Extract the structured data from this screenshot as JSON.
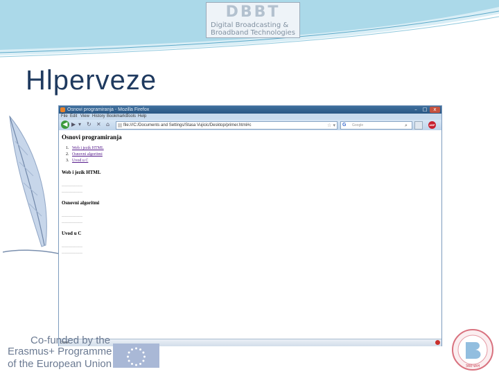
{
  "slide": {
    "title": "Hlperveze",
    "logo_title": "DBBT",
    "logo_line1": "Digital Broadcasting &",
    "logo_line2": "Broadband Technologies",
    "cofunded": "Co-funded by the",
    "erasmus_line1": "Erasmus+ Programme",
    "erasmus_line2": "of the European Union"
  },
  "browser": {
    "window_title": "Osnovi programiranja - Mozilla Firefox",
    "window_buttons": {
      "minimize": "–",
      "maximize": "□",
      "close": "x"
    },
    "menu": [
      "File",
      "Edit",
      "View",
      "History",
      "Bookmarks",
      "Tools",
      "Help"
    ],
    "url": "file:///C:/Documents and Settings/Stasa Vujicic/Desktop/primer.html#c",
    "search_placeholder": "Google",
    "status": "Done"
  },
  "page": {
    "heading": "Osnovi programiranja",
    "toc": [
      {
        "num": "1.",
        "label": "Web i jezik HTML"
      },
      {
        "num": "2.",
        "label": "Osnovni algoritmi"
      },
      {
        "num": "3.",
        "label": "Uvod u C"
      }
    ],
    "sections": [
      {
        "title": "Web i jezik HTML",
        "lines": [
          "……………",
          "……………"
        ]
      },
      {
        "title": "Osnovni algoritmi",
        "lines": [
          "……………",
          "……………"
        ]
      },
      {
        "title": "Uvod u C",
        "lines": [
          "……………",
          "……………"
        ]
      }
    ]
  },
  "colors": {
    "title": "#1f3a5f",
    "titlebar": "#2a5784",
    "link_visited": "#551a8b"
  }
}
